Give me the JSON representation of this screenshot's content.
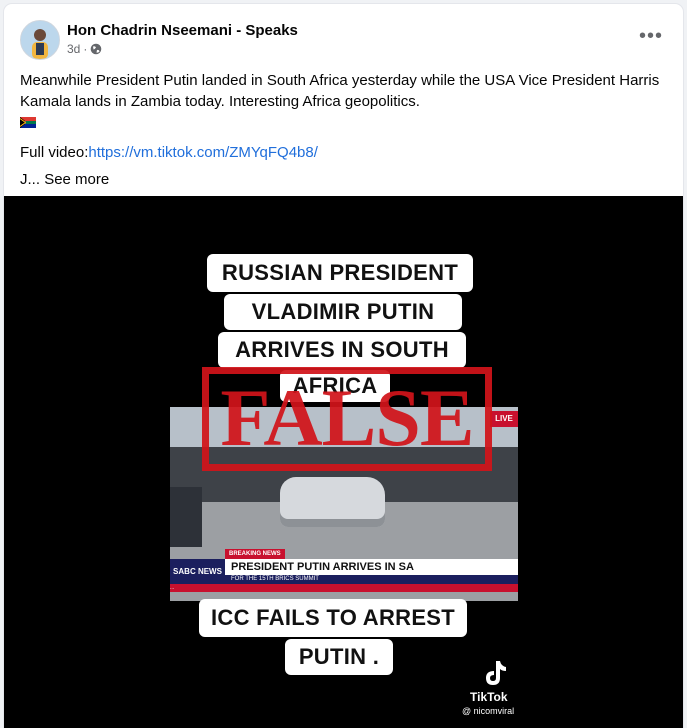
{
  "post": {
    "author": "Hon Chadrin Nseemani - Speaks",
    "time": "3d",
    "separator": "·",
    "more_label": "•••",
    "text_line1": "Meanwhile President Putin landed in South Africa yesterday while the USA Vice President Harris Kamala lands in Zambia today. Interesting Africa geopolitics.",
    "video_prefix": "Full video:",
    "video_link": "https://vm.tiktok.com/ZMYqFQ4b8/",
    "truncated_prefix": "J...",
    "see_more": "See more"
  },
  "media": {
    "caption_top_1": "RUSSIAN PRESIDENT",
    "caption_top_2": "VLADIMIR PUTIN",
    "caption_top_3": "ARRIVES IN SOUTH",
    "caption_top_4": "AFRICA",
    "stamp": "FALSE",
    "live_badge": "LIVE",
    "ticker_top": "BREAKING NEWS",
    "ticker_main": "PRESIDENT PUTIN ARRIVES IN SA",
    "ticker_sub": "FOR THE 15TH BRICS SUMMIT",
    "ticker_brand": "SABC NEWS",
    "ticker_scroll": "...",
    "caption_bottom_1": "ICC FAILS TO ARREST",
    "caption_bottom_2": "PUTIN .",
    "tiktok_name": "TikTok",
    "tiktok_handle": "@ nicomviral"
  },
  "colors": {
    "link": "#216fdb",
    "stamp": "#d1141a"
  }
}
